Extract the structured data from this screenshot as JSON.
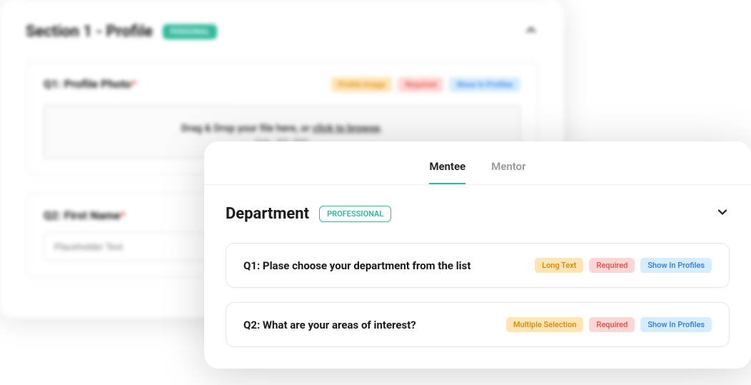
{
  "bg": {
    "section_title": "Section 1 - Profile",
    "section_badge": "PERSONAL",
    "q1": {
      "title_prefix": "Q1: ",
      "title_text": "Profile Photo",
      "tag_type": "Profile Image",
      "tag_required": "Required",
      "tag_show": "Show In Profiles",
      "dropzone_main": "Drag & Drop your file here, or ",
      "dropzone_link": "click to browse",
      "dropzone_suffix": ".",
      "dropzone_hint": "Only .JPG .PNG"
    },
    "q2": {
      "title_prefix": "Q2: ",
      "title_text": "First Name",
      "placeholder": "Placeholder Text"
    }
  },
  "fg": {
    "tabs": {
      "mentee": "Mentee",
      "mentor": "Mentor"
    },
    "section_title": "Department",
    "section_badge": "PROFESSIONAL",
    "q1": {
      "title": "Q1: Plase choose your department from the list",
      "tag_type": "Long Text",
      "tag_required": "Required",
      "tag_show": "Show In Profiles"
    },
    "q2": {
      "title": "Q2: What are your areas of interest?",
      "tag_type": "Multiple Selection",
      "tag_required": "Required",
      "tag_show": "Show In Profiles"
    }
  }
}
